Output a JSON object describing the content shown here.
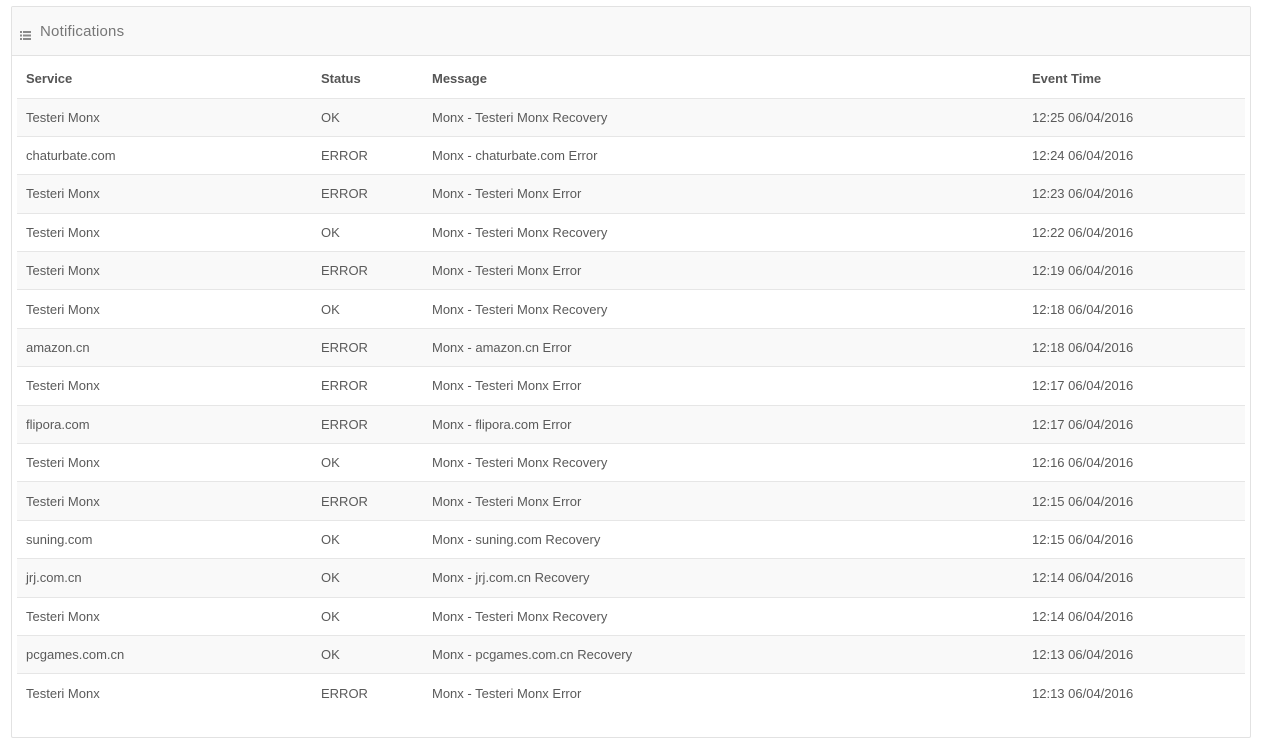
{
  "panel": {
    "title": "Notifications",
    "icon": "list-icon"
  },
  "table": {
    "columns": [
      "Service",
      "Status",
      "Message",
      "Event Time"
    ],
    "rows": [
      {
        "service": "Testeri Monx",
        "status": "OK",
        "message": "Monx - Testeri Monx Recovery",
        "time": "12:25 06/04/2016"
      },
      {
        "service": "chaturbate.com",
        "status": "ERROR",
        "message": "Monx - chaturbate.com Error",
        "time": "12:24 06/04/2016"
      },
      {
        "service": "Testeri Monx",
        "status": "ERROR",
        "message": "Monx - Testeri Monx Error",
        "time": "12:23 06/04/2016"
      },
      {
        "service": "Testeri Monx",
        "status": "OK",
        "message": "Monx - Testeri Monx Recovery",
        "time": "12:22 06/04/2016"
      },
      {
        "service": "Testeri Monx",
        "status": "ERROR",
        "message": "Monx - Testeri Monx Error",
        "time": "12:19 06/04/2016"
      },
      {
        "service": "Testeri Monx",
        "status": "OK",
        "message": "Monx - Testeri Monx Recovery",
        "time": "12:18 06/04/2016"
      },
      {
        "service": "amazon.cn",
        "status": "ERROR",
        "message": "Monx - amazon.cn Error",
        "time": "12:18 06/04/2016"
      },
      {
        "service": "Testeri Monx",
        "status": "ERROR",
        "message": "Monx - Testeri Monx Error",
        "time": "12:17 06/04/2016"
      },
      {
        "service": "flipora.com",
        "status": "ERROR",
        "message": "Monx - flipora.com Error",
        "time": "12:17 06/04/2016"
      },
      {
        "service": "Testeri Monx",
        "status": "OK",
        "message": "Monx - Testeri Monx Recovery",
        "time": "12:16 06/04/2016"
      },
      {
        "service": "Testeri Monx",
        "status": "ERROR",
        "message": "Monx - Testeri Monx Error",
        "time": "12:15 06/04/2016"
      },
      {
        "service": "suning.com",
        "status": "OK",
        "message": "Monx - suning.com Recovery",
        "time": "12:15 06/04/2016"
      },
      {
        "service": "jrj.com.cn",
        "status": "OK",
        "message": "Monx - jrj.com.cn Recovery",
        "time": "12:14 06/04/2016"
      },
      {
        "service": "Testeri Monx",
        "status": "OK",
        "message": "Monx - Testeri Monx Recovery",
        "time": "12:14 06/04/2016"
      },
      {
        "service": "pcgames.com.cn",
        "status": "OK",
        "message": "Monx - pcgames.com.cn Recovery",
        "time": "12:13 06/04/2016"
      },
      {
        "service": "Testeri Monx",
        "status": "ERROR",
        "message": "Monx - Testeri Monx Error",
        "time": "12:13 06/04/2016"
      }
    ]
  },
  "colors": {
    "header_bg": "#f9f9f9",
    "stripe": "#f9f9f9",
    "border": "#e6e6e6",
    "text": "#555555"
  }
}
